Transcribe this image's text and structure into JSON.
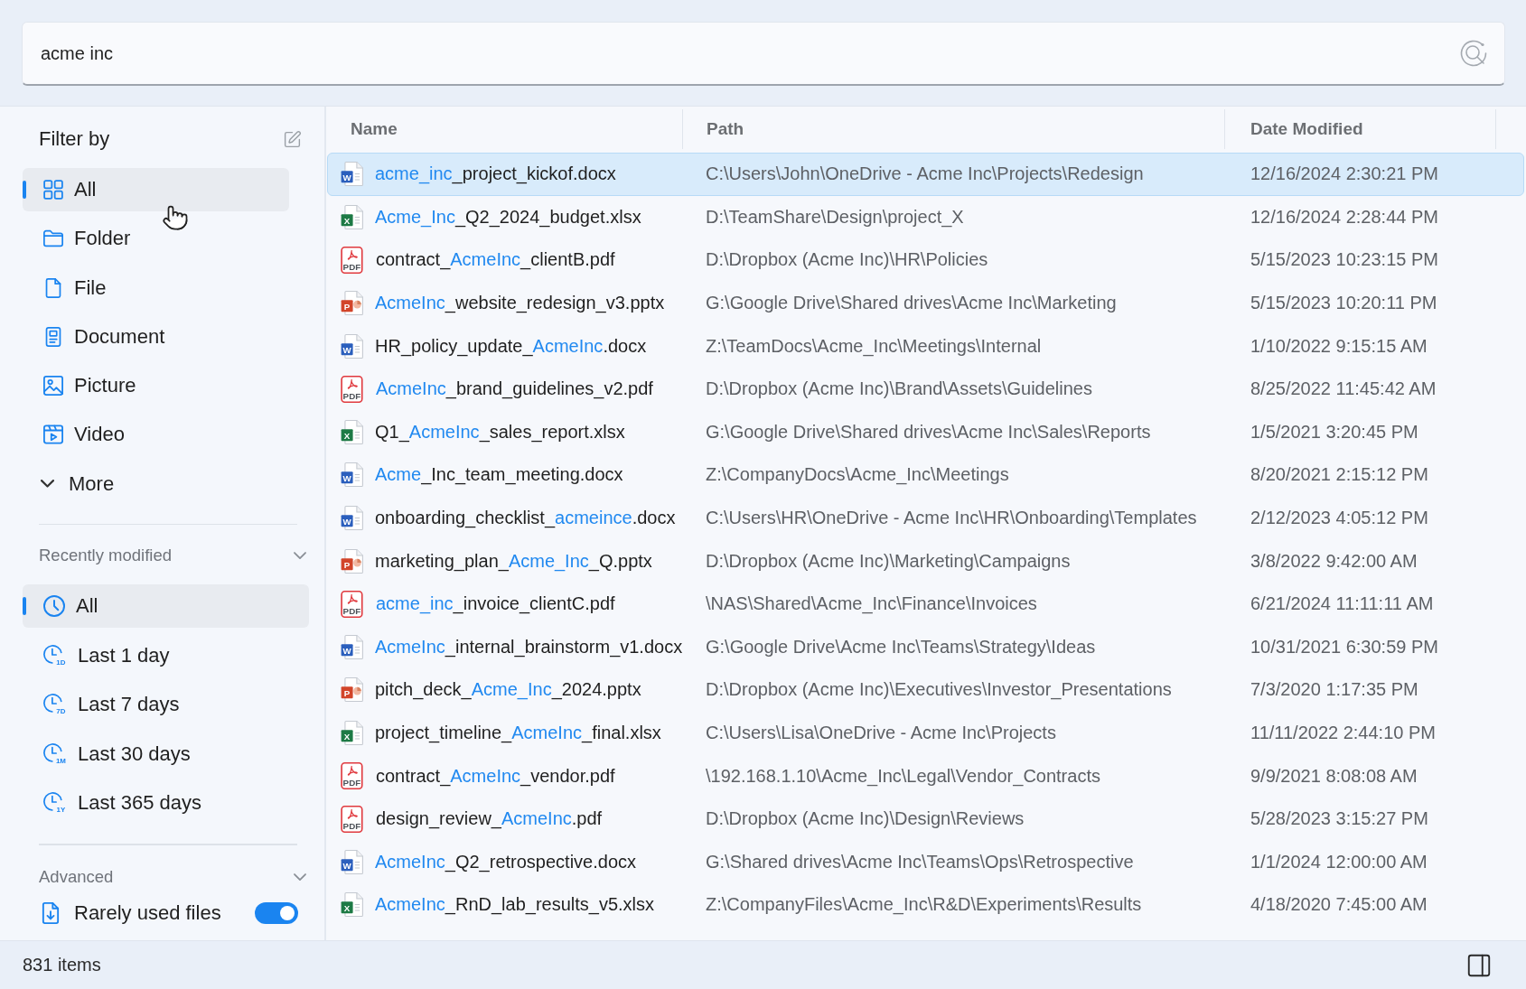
{
  "search": {
    "value": "acme inc"
  },
  "sidebar": {
    "filter": {
      "title": "Filter by",
      "items": [
        {
          "kind": "all",
          "label": "All",
          "selected": true
        },
        {
          "kind": "folder",
          "label": "Folder",
          "selected": false
        },
        {
          "kind": "file",
          "label": "File",
          "selected": false
        },
        {
          "kind": "document",
          "label": "Document",
          "selected": false
        },
        {
          "kind": "picture",
          "label": "Picture",
          "selected": false
        },
        {
          "kind": "video",
          "label": "Video",
          "selected": false
        }
      ],
      "more": {
        "label": "More"
      }
    },
    "recently_modified": {
      "title": "Recently modified",
      "items": [
        {
          "kind": "all",
          "label": "All",
          "selected": true
        },
        {
          "kind": "period",
          "label": "Last 1 day",
          "badge": "1D",
          "selected": false
        },
        {
          "kind": "period",
          "label": "Last 7 days",
          "badge": "7D",
          "selected": false
        },
        {
          "kind": "period",
          "label": "Last 30 days",
          "badge": "1M",
          "selected": false
        },
        {
          "kind": "period",
          "label": "Last 365 days",
          "badge": "1Y",
          "selected": false
        }
      ]
    },
    "advanced": {
      "title": "Advanced",
      "items": [
        {
          "label": "Rarely used files",
          "on": true
        }
      ]
    }
  },
  "table": {
    "columns": [
      "Name",
      "Path",
      "Date Modified"
    ],
    "rows": [
      {
        "kind": "doc",
        "badge": "W",
        "name": [
          {
            "text": "acme_inc",
            "match": true
          },
          {
            "text": "_project_kickof.docx",
            "match": false
          }
        ],
        "path": "C:\\Users\\John\\OneDrive - Acme Inc\\Projects\\Redesign",
        "date": "12/16/2024 2:30:21 PM",
        "selected": true
      },
      {
        "kind": "sheet",
        "badge": "X",
        "name": [
          {
            "text": "Acme_Inc",
            "match": true
          },
          {
            "text": "_Q2_2024_budget.xlsx",
            "match": false
          }
        ],
        "path": "D:\\TeamShare\\Design\\project_X",
        "date": "12/16/2024 2:28:44 PM",
        "selected": false
      },
      {
        "kind": "pdf",
        "badge": "PDF",
        "name": [
          {
            "text": "contract_",
            "match": false
          },
          {
            "text": "AcmeInc",
            "match": true
          },
          {
            "text": "_clientB.pdf",
            "match": false
          }
        ],
        "path": "D:\\Dropbox (Acme Inc)\\HR\\Policies",
        "date": "5/15/2023 10:23:15 PM",
        "selected": false
      },
      {
        "kind": "slides",
        "badge": "P",
        "name": [
          {
            "text": "AcmeInc",
            "match": true
          },
          {
            "text": "_website_redesign_v3.pptx",
            "match": false
          }
        ],
        "path": "G:\\Google Drive\\Shared drives\\Acme Inc\\Marketing",
        "date": "5/15/2023 10:20:11 PM",
        "selected": false
      },
      {
        "kind": "doc",
        "badge": "W",
        "name": [
          {
            "text": "HR_policy_update_",
            "match": false
          },
          {
            "text": "AcmeInc",
            "match": true
          },
          {
            "text": ".docx",
            "match": false
          }
        ],
        "path": "Z:\\TeamDocs\\Acme_Inc\\Meetings\\Internal",
        "date": "1/10/2022 9:15:15 AM",
        "selected": false
      },
      {
        "kind": "pdf",
        "badge": "PDF",
        "name": [
          {
            "text": "AcmeInc",
            "match": true
          },
          {
            "text": "_brand_guidelines_v2.pdf",
            "match": false
          }
        ],
        "path": "D:\\Dropbox (Acme Inc)\\Brand\\Assets\\Guidelines",
        "date": "8/25/2022 11:45:42 AM",
        "selected": false
      },
      {
        "kind": "sheet",
        "badge": "X",
        "name": [
          {
            "text": "Q1_",
            "match": false
          },
          {
            "text": "AcmeInc",
            "match": true
          },
          {
            "text": "_sales_report.xlsx",
            "match": false
          }
        ],
        "path": "G:\\Google Drive\\Shared drives\\Acme Inc\\Sales\\Reports",
        "date": "1/5/2021 3:20:45 PM",
        "selected": false
      },
      {
        "kind": "doc",
        "badge": "W",
        "name": [
          {
            "text": "Acme",
            "match": true
          },
          {
            "text": "_Inc_team_meeting.docx",
            "match": false
          }
        ],
        "path": "Z:\\CompanyDocs\\Acme_Inc\\Meetings",
        "date": "8/20/2021 2:15:12 PM",
        "selected": false
      },
      {
        "kind": "doc",
        "badge": "W",
        "name": [
          {
            "text": "onboarding_checklist_",
            "match": false
          },
          {
            "text": "acmeince",
            "match": true
          },
          {
            "text": ".docx",
            "match": false
          }
        ],
        "path": "C:\\Users\\HR\\OneDrive - Acme Inc\\HR\\Onboarding\\Templates",
        "date": "2/12/2023 4:05:12 PM",
        "selected": false
      },
      {
        "kind": "slides",
        "badge": "P",
        "name": [
          {
            "text": "marketing_plan_",
            "match": false
          },
          {
            "text": "Acme_Inc",
            "match": true
          },
          {
            "text": "_Q.pptx",
            "match": false
          }
        ],
        "path": "D:\\Dropbox (Acme Inc)\\Marketing\\Campaigns",
        "date": "3/8/2022 9:42:00 AM",
        "selected": false
      },
      {
        "kind": "pdf",
        "badge": "PDF",
        "name": [
          {
            "text": "acme_inc",
            "match": true
          },
          {
            "text": "_invoice_clientC.pdf",
            "match": false
          }
        ],
        "path": "\\NAS\\Shared\\Acme_Inc\\Finance\\Invoices",
        "date": "6/21/2024 11:11:11 AM",
        "selected": false
      },
      {
        "kind": "doc",
        "badge": "W",
        "name": [
          {
            "text": "AcmeInc",
            "match": true
          },
          {
            "text": "_internal_brainstorm_v1.docx",
            "match": false
          }
        ],
        "path": "G:\\Google Drive\\Acme Inc\\Teams\\Strategy\\Ideas",
        "date": "10/31/2021 6:30:59 PM",
        "selected": false
      },
      {
        "kind": "slides",
        "badge": "P",
        "name": [
          {
            "text": "pitch_deck_",
            "match": false
          },
          {
            "text": "Acme_Inc",
            "match": true
          },
          {
            "text": "_2024.pptx",
            "match": false
          }
        ],
        "path": "D:\\Dropbox (Acme Inc)\\Executives\\Investor_Presentations",
        "date": "7/3/2020 1:17:35 PM",
        "selected": false
      },
      {
        "kind": "sheet",
        "badge": "X",
        "name": [
          {
            "text": "project_timeline_",
            "match": false
          },
          {
            "text": "AcmeInc",
            "match": true
          },
          {
            "text": "_final.xlsx",
            "match": false
          }
        ],
        "path": "C:\\Users\\Lisa\\OneDrive - Acme Inc\\Projects",
        "date": "11/11/2022 2:44:10 PM",
        "selected": false
      },
      {
        "kind": "pdf",
        "badge": "PDF",
        "name": [
          {
            "text": "contract_",
            "match": false
          },
          {
            "text": "AcmeInc",
            "match": true
          },
          {
            "text": "_vendor.pdf",
            "match": false
          }
        ],
        "path": "\\192.168.1.10\\Acme_Inc\\Legal\\Vendor_Contracts",
        "date": "9/9/2021 8:08:08 AM",
        "selected": false
      },
      {
        "kind": "pdf",
        "badge": "PDF",
        "name": [
          {
            "text": "design_review_",
            "match": false
          },
          {
            "text": "AcmeInc",
            "match": true
          },
          {
            "text": ".pdf",
            "match": false
          }
        ],
        "path": "D:\\Dropbox (Acme Inc)\\Design\\Reviews",
        "date": "5/28/2023 3:15:27 PM",
        "selected": false
      },
      {
        "kind": "doc",
        "badge": "W",
        "name": [
          {
            "text": "AcmeInc",
            "match": true
          },
          {
            "text": "_Q2_retrospective.docx",
            "match": false
          }
        ],
        "path": "G:\\Shared drives\\Acme Inc\\Teams\\Ops\\Retrospective",
        "date": "1/1/2024 12:00:00 AM",
        "selected": false
      },
      {
        "kind": "sheet",
        "badge": "X",
        "name": [
          {
            "text": "AcmeInc",
            "match": true
          },
          {
            "text": "_RnD_lab_results_v5.xlsx",
            "match": false
          }
        ],
        "path": "Z:\\CompanyFiles\\Acme_Inc\\R&D\\Experiments\\Results",
        "date": "4/18/2020 7:45:00 AM",
        "selected": false
      }
    ]
  },
  "status_bar": {
    "count": "831 items"
  }
}
